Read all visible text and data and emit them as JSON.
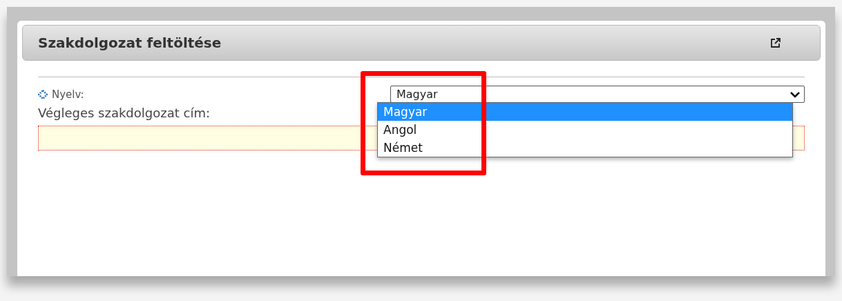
{
  "dialog": {
    "title": "Szakdolgozat feltöltése"
  },
  "form": {
    "language_label": "Nyelv:",
    "language_value": "Magyar",
    "language_options": [
      {
        "label": "Magyar",
        "selected": true
      },
      {
        "label": "Angol",
        "selected": false
      },
      {
        "label": "Német",
        "selected": false
      }
    ],
    "title_label": "Végleges szakdolgozat cím:"
  }
}
